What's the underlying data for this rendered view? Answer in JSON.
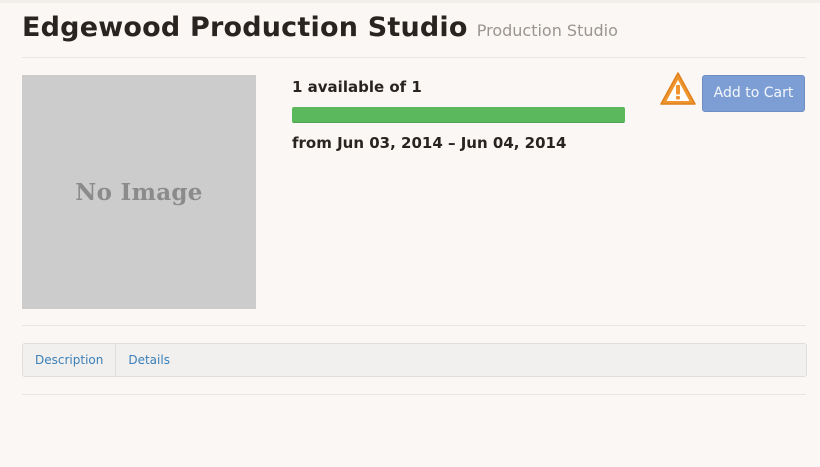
{
  "header": {
    "title": "Edgewood Production Studio",
    "subtitle": "Production Studio"
  },
  "image": {
    "placeholder_text": "No Image"
  },
  "availability": {
    "text": "1 available of 1",
    "available": 1,
    "total": 1,
    "fraction": 1.0,
    "bar_color": "#5cb85c"
  },
  "date_range": {
    "text": "from Jun 03, 2014 – Jun 04, 2014"
  },
  "actions": {
    "warning_icon": "warning-triangle-icon",
    "warning_color": "#f0952e",
    "add_to_cart_label": "Add to Cart",
    "add_to_cart_color": "#7d9ed4"
  },
  "tabs": [
    {
      "label": "Description"
    },
    {
      "label": "Details"
    }
  ],
  "colors": {
    "background": "#fbf7f4",
    "link": "#3a7fb7"
  }
}
